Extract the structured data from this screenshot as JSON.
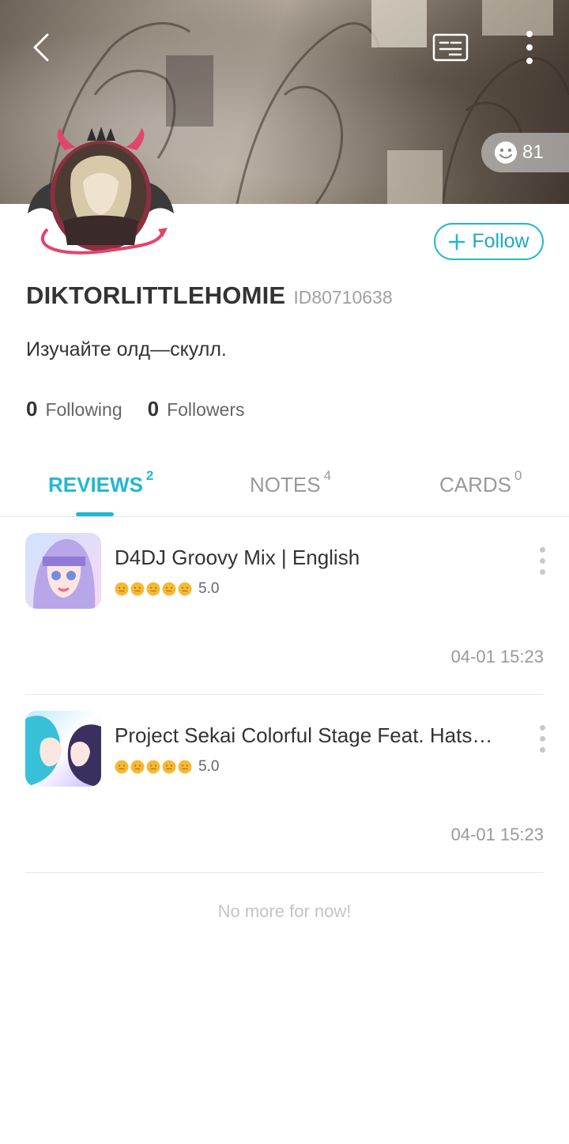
{
  "banner": {
    "icons": [
      "back-arrow-icon",
      "profile-card-icon",
      "more-vertical-icon"
    ],
    "like_count": "81"
  },
  "profile": {
    "follow_label": "Follow",
    "username": "DIKTORLITTLEHOMIE",
    "user_id": "ID80710638",
    "bio": "Изучайте олд—скулл.",
    "following_count": "0",
    "following_label": "Following",
    "followers_count": "0",
    "followers_label": "Followers"
  },
  "tabs": [
    {
      "label": "REVIEWS",
      "count": "2",
      "active": true
    },
    {
      "label": "NOTES",
      "count": "4",
      "active": false
    },
    {
      "label": "CARDS",
      "count": "0",
      "active": false
    }
  ],
  "reviews": [
    {
      "title": "D4DJ Groovy Mix | English",
      "rating": "5.0",
      "stars": 5,
      "date": "04-01 15:23"
    },
    {
      "title": "Project Sekai Colorful Stage Feat. Hatsune Miku",
      "rating": "5.0",
      "stars": 5,
      "date": "04-01 15:23"
    }
  ],
  "end_note": "No more for now!",
  "colors": {
    "accent": "#22b8cf",
    "star": "#f5b935"
  }
}
